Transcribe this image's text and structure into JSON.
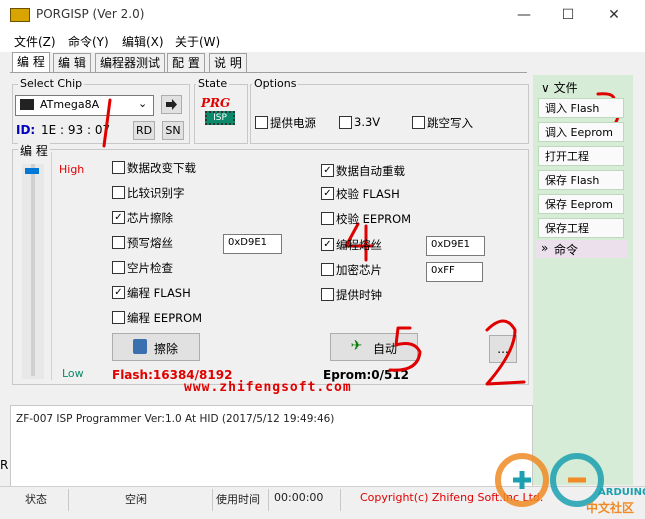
{
  "window": {
    "title": "PORGISP (Ver 2.0)",
    "minimize": "—",
    "maximize": "☐",
    "close": "✕"
  },
  "menu": [
    "文件(Z)",
    "命令(Y)",
    "编辑(X)",
    "关于(W)"
  ],
  "tabs": [
    "编 程",
    "编 辑",
    "编程器测试",
    "配 置",
    "说 明"
  ],
  "chip": {
    "group_label": "Select Chip",
    "selected": "ATmega8A",
    "id_label": "ID:",
    "id_value": "1E : 93 : 07",
    "rd": "RD",
    "sn": "SN"
  },
  "state": {
    "label": "State",
    "logo_top": "PRG",
    "logo_bottom": "ISP"
  },
  "options": {
    "label": "Options",
    "items": [
      {
        "label": "提供电源",
        "checked": false
      },
      {
        "label": "3.3V",
        "checked": false
      },
      {
        "label": "跳空写入",
        "checked": false
      }
    ]
  },
  "program": {
    "label": "编 程",
    "high": "High",
    "low": "Low",
    "left_items": [
      {
        "label": "数据改变下载",
        "checked": false
      },
      {
        "label": "比较识别字",
        "checked": false
      },
      {
        "label": "芯片擦除",
        "checked": true
      },
      {
        "label": "预写熔丝",
        "checked": false
      },
      {
        "label": "空片检查",
        "checked": false
      },
      {
        "label": "编程 FLASH",
        "checked": true
      },
      {
        "label": "编程 EEPROM",
        "checked": false
      }
    ],
    "right_items": [
      {
        "label": "数据自动重载",
        "checked": true
      },
      {
        "label": "校验 FLASH",
        "checked": true
      },
      {
        "label": "校验 EEPROM",
        "checked": false
      },
      {
        "label": "编程熔丝",
        "checked": true
      },
      {
        "label": "加密芯片",
        "checked": false
      },
      {
        "label": "提供时钟",
        "checked": false
      }
    ],
    "prefuse_value": "0xD9E1",
    "fuse_value": "0xD9E1",
    "lock_value": "0xFF",
    "erase_button": "擦除",
    "auto_button": "自动",
    "more_button": "...",
    "flash_info": "Flash:16384/8192",
    "eeprom_info": "Eprom:0/512",
    "website": "www.zhifengsoft.com"
  },
  "right_panel": {
    "file_header": "文件",
    "buttons": [
      "调入 Flash",
      "调入 Eeprom",
      "打开工程",
      "保存 Flash",
      "保存 Eeprom",
      "保存工程"
    ],
    "command_header": "命令"
  },
  "log": "ZF-007 ISP Programmer Ver:1.0 At HID (2017/5/12 19:49:46)",
  "status": {
    "state_label": "状态",
    "state_value": "空闲",
    "time_label": "使用时间",
    "time_value": "00:00:00",
    "copyright": "Copyright(c) Zhifeng Soft.Inc Ltd.",
    "side_char": "R"
  },
  "watermark": {
    "brand": "ARDUINO",
    "sub": "中文社区"
  },
  "annotations": [
    "1",
    "2",
    "3",
    "4",
    "5"
  ],
  "colors": {
    "annotation": "#e00000",
    "panel": "#d6ecd6",
    "info_red": "#e00000"
  }
}
